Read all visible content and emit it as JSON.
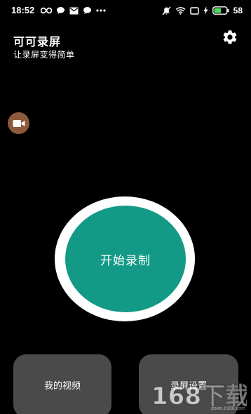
{
  "status_bar": {
    "time": "18:52",
    "battery_percent": "58",
    "icons_left": [
      "infinity-icon",
      "chat-bubble-icon",
      "mail-icon",
      "chat-bubble-icon",
      "more-dots-icon"
    ],
    "icons_right": [
      "mute-icon",
      "wifi-icon",
      "screen-icon",
      "charging-icon",
      "battery-icon"
    ],
    "battery_level": 0.58,
    "battery_color": "#4cd964"
  },
  "header": {
    "title": "可可录屏",
    "subtitle": "让录屏变得简单",
    "settings_icon": "gear-icon"
  },
  "floating_bubble": {
    "icon": "video-camera-icon",
    "color": "#8d5a3c"
  },
  "record": {
    "label": "开始录制",
    "color": "#139a86",
    "ring_color": "#ffffff"
  },
  "cards": {
    "my_videos": "我的视频",
    "record_settings": "录屏设置",
    "color": "#4a4a4a"
  },
  "watermark": {
    "text": "168下载",
    "domain": "down.it168.com"
  }
}
